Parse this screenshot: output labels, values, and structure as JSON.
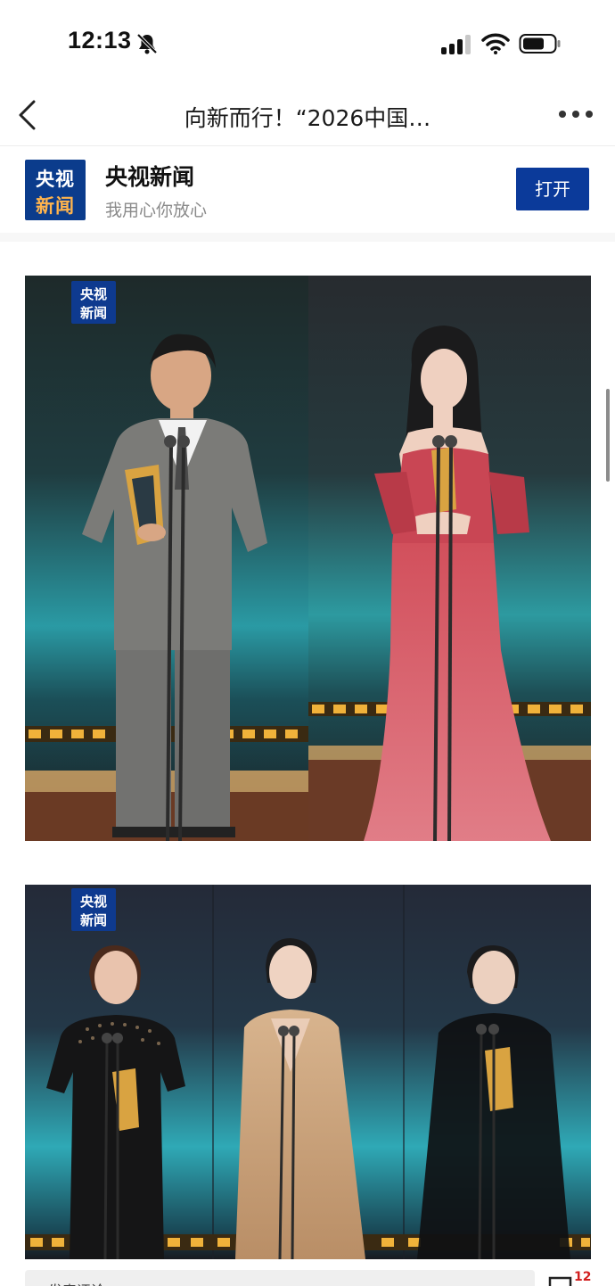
{
  "status_bar": {
    "time": "12:13",
    "icons": [
      "bell-slash-icon",
      "signal-icon",
      "wifi-icon",
      "battery-icon"
    ]
  },
  "nav": {
    "title": "向新而行！“2026中国…",
    "back_icon": "chevron-left-icon",
    "more_icon": "more-dots-icon"
  },
  "banner": {
    "logo_line1": "央视",
    "logo_line2": "新闻",
    "app_name": "央视新闻",
    "slogan": "我用心你放心",
    "open_label": "打开",
    "accent": "#0b3a9a"
  },
  "photos": [
    {
      "watermark_line1": "央视",
      "watermark_line2": "新闻"
    },
    {
      "watermark_line1": "央视",
      "watermark_line2": "新闻"
    }
  ],
  "bottom": {
    "partial_text": "发表评论",
    "comment_count": "12",
    "comment_icon": "comment-icon"
  }
}
